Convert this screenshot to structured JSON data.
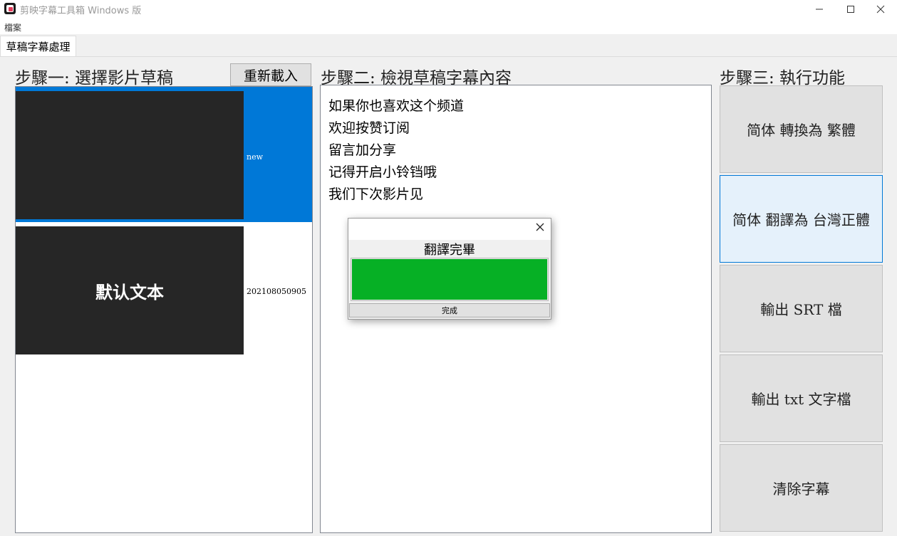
{
  "window": {
    "title": "剪映字幕工具箱 Windows 版"
  },
  "menu": {
    "file": "檔案"
  },
  "tabs": [
    {
      "label": "草稿字幕處理"
    }
  ],
  "step1": {
    "heading": "步驟一: 選擇影片草稿",
    "reload_label": "重新載入",
    "drafts": [
      {
        "thumb_text": "",
        "name": "new"
      },
      {
        "thumb_text": "默认文本",
        "name": "202108050905"
      }
    ]
  },
  "step2": {
    "heading": "步驟二: 檢視草稿字幕內容",
    "lines": [
      "如果你也喜欢这个频道",
      "欢迎按赞订阅",
      "留言加分享",
      "记得开启小铃铛哦",
      "我们下次影片见"
    ]
  },
  "step3": {
    "heading": "步驟三: 執行功能",
    "buttons": [
      "简体 轉換為 繁體",
      "简体 翻譯為 台灣正體",
      "輸出 SRT 檔",
      "輸出 txt 文字檔",
      "清除字幕"
    ]
  },
  "dialog": {
    "message": "翻譯完畢",
    "progress": 1.0,
    "done_label": "完成"
  },
  "colors": {
    "selection": "#0078d7",
    "progress": "#06b025"
  }
}
